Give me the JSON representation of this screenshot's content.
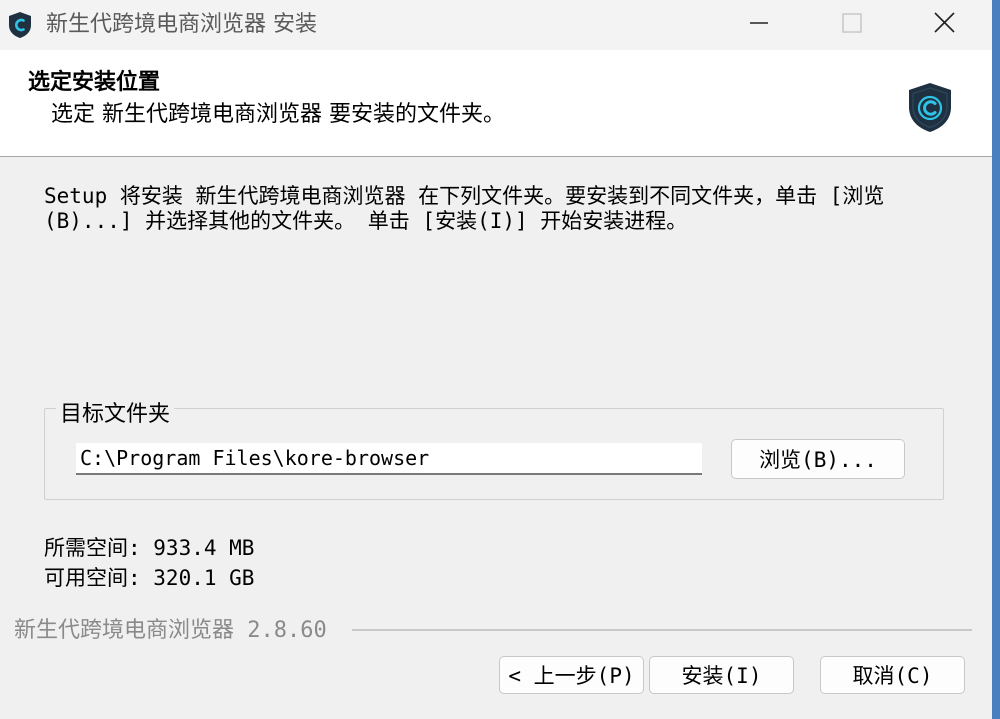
{
  "window": {
    "title": "新生代跨境电商浏览器 安装"
  },
  "header": {
    "title": "选定安装位置",
    "subtitle": " 选定 新生代跨境电商浏览器 要安装的文件夹。"
  },
  "description": "Setup 将安装 新生代跨境电商浏览器 在下列文件夹。要安装到不同文件夹，单击 [浏览(B)...] 并选择其他的文件夹。 单击 [安装(I)] 开始安装进程。",
  "destination": {
    "legend": "目标文件夹",
    "path": "C:\\Program Files\\kore-browser",
    "browse_label": "浏览(B)..."
  },
  "space": {
    "required": "所需空间: 933.4 MB",
    "available": "可用空间: 320.1 GB"
  },
  "footer": {
    "brand": "新生代跨境电商浏览器 2.8.60"
  },
  "buttons": {
    "back": "< 上一步(P)",
    "install": "安装(I)",
    "cancel": "取消(C)"
  },
  "icons": {
    "app": "shield-c-icon",
    "minimize": "minimize-icon",
    "maximize": "maximize-icon",
    "close": "close-icon"
  },
  "colors": {
    "shield_dark": "#1f3040",
    "shield_accent": "#2ec4e8"
  }
}
